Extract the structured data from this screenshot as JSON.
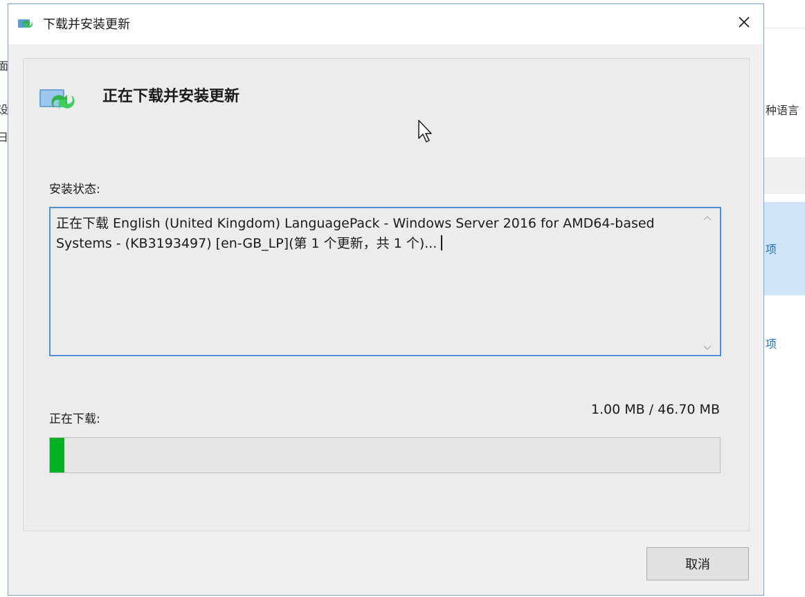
{
  "background": {
    "left_chars": [
      "面",
      "设",
      "日"
    ],
    "right_text": "种语言",
    "right_items": [
      "项",
      "项"
    ]
  },
  "dialog": {
    "title": "下载并安装更新",
    "close_symbol": "✕",
    "heading": "正在下载并安装更新",
    "status_label": "安装状态:",
    "status_text": "正在下载 English (United Kingdom) LanguagePack - Windows Server 2016 for AMD64-based Systems - (KB3193497) [en-GB_LP](第 1 个更新，共 1 个)...",
    "download_label": "正在下载:",
    "download_size": "1.00 MB / 46.70 MB",
    "progress_fraction": 0.0214,
    "cancel_label": "取消"
  },
  "icons": {
    "title": "windows-update-icon",
    "header": "windows-update-icon",
    "scroll_up": "chevron-up-icon",
    "scroll_down": "chevron-down-icon",
    "cursor": "mouse-pointer-icon"
  },
  "colors": {
    "progress": "#06b025",
    "focus_border": "#4e8fd8",
    "window_border": "#7a9fd0"
  }
}
